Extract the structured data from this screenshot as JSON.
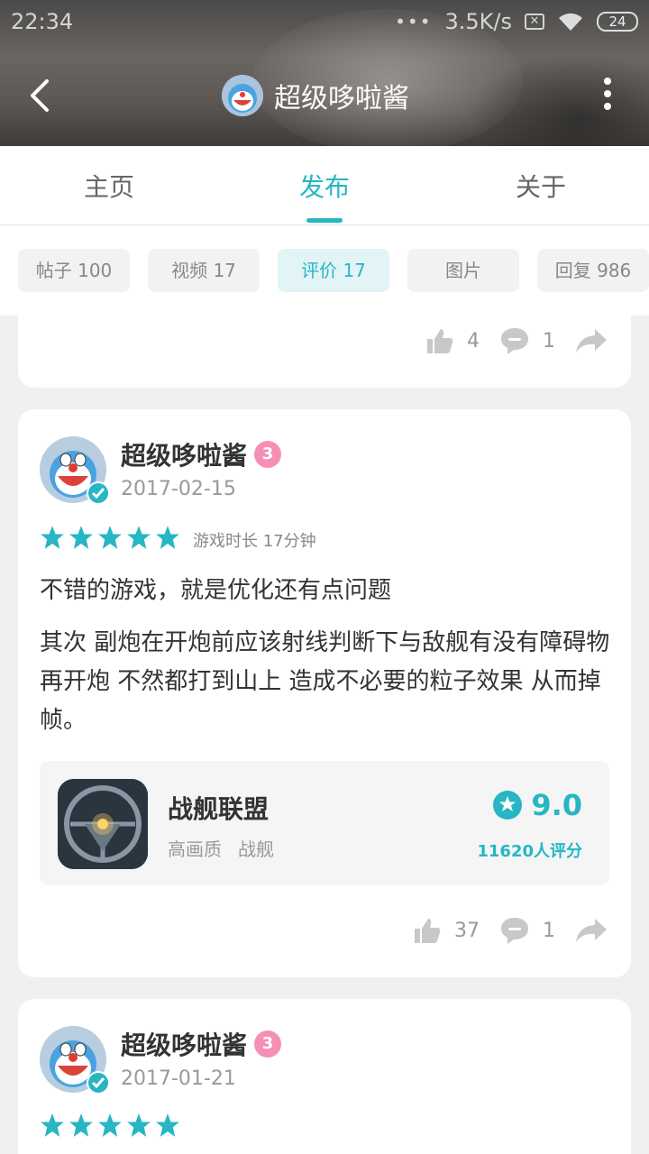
{
  "status_bar": {
    "time": "22:34",
    "more": "•••",
    "net_speed": "3.5K/s",
    "battery": "24"
  },
  "header": {
    "title": "超级哆啦酱"
  },
  "tabs": [
    {
      "label": "主页"
    },
    {
      "label": "发布"
    },
    {
      "label": "关于"
    }
  ],
  "filters": [
    {
      "label": "帖子 100"
    },
    {
      "label": "视频 17"
    },
    {
      "label": "评价 17"
    },
    {
      "label": "图片"
    },
    {
      "label": "回复 986"
    }
  ],
  "previous_card": {
    "likes": "4",
    "comments": "1"
  },
  "review": {
    "author": "超级哆啦酱",
    "level": "3",
    "date": "2017-02-15",
    "stars": 5,
    "play_time": "游戏时长 17分钟",
    "title": "不错的游戏，就是优化还有点问题",
    "body": "其次 副炮在开炮前应该射线判断下与敌舰有没有障碍物再开炮 不然都打到山上 造成不必要的粒子效果 从而掉帧。",
    "game": {
      "name": "战舰联盟",
      "tags": [
        "高画质",
        "战舰"
      ],
      "score": "9.0",
      "rating_count": "11620人评分"
    },
    "likes": "37",
    "comments": "1"
  },
  "next_review": {
    "author": "超级哆啦酱",
    "level": "3",
    "date": "2017-01-21",
    "stars": 5
  },
  "colors": {
    "accent": "#26b6c4",
    "level_badge": "#f58fb5"
  }
}
